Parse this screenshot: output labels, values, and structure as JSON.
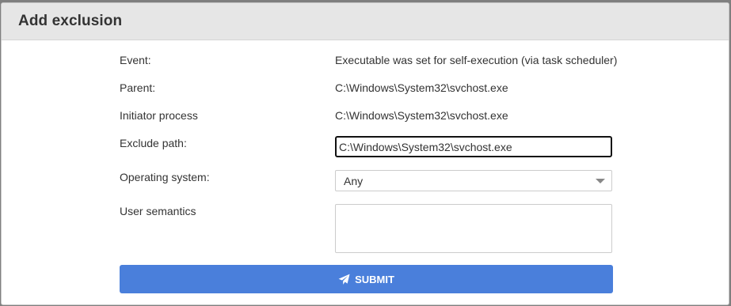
{
  "dialog": {
    "title": "Add exclusion"
  },
  "fields": {
    "event": {
      "label": "Event:",
      "value": "Executable was set for self-execution (via task scheduler)"
    },
    "parent": {
      "label": "Parent:",
      "value": "C:\\Windows\\System32\\svchost.exe"
    },
    "initiator": {
      "label": "Initiator process",
      "value": "C:\\Windows\\System32\\svchost.exe"
    },
    "exclude_path": {
      "label": "Exclude path:",
      "value": "C:\\Windows\\System32\\svchost.exe"
    },
    "operating_system": {
      "label": "Operating system:",
      "selected": "Any"
    },
    "user_semantics": {
      "label": "User semantics",
      "value": ""
    }
  },
  "submit": {
    "label": "SUBMIT",
    "icon": "paper-plane-icon",
    "color": "#4a7fdb"
  }
}
